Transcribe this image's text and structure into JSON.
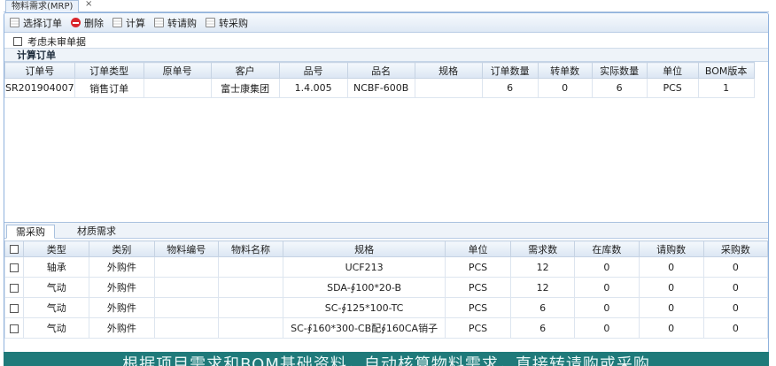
{
  "window": {
    "tab_title": "物料需求(MRP)",
    "close_glyph": "×"
  },
  "toolbar": {
    "select_order": "选择订单",
    "delete": "删除",
    "calculate": "计算",
    "to_request": "转请购",
    "to_purchase": "转采购"
  },
  "option": {
    "label": "考虑未审单据"
  },
  "orders": {
    "title": "计算订单",
    "columns": [
      "订单号",
      "订单类型",
      "原单号",
      "客户",
      "品号",
      "品名",
      "规格",
      "订单数量",
      "转单数",
      "实际数量",
      "单位",
      "BOM版本"
    ],
    "rows": [
      [
        "SR201904007",
        "销售订单",
        "",
        "富士康集团",
        "1.4.005",
        "NCBF-600B",
        "",
        "6",
        "0",
        "6",
        "PCS",
        "1"
      ]
    ]
  },
  "bottom_tabs": [
    "需采购",
    "材质需求"
  ],
  "requirements": {
    "columns": [
      "类型",
      "类别",
      "物料编号",
      "物料名称",
      "规格",
      "单位",
      "需求数",
      "在库数",
      "请购数",
      "采购数"
    ],
    "rows": [
      [
        "轴承",
        "外购件",
        "",
        "",
        "UCF213",
        "PCS",
        "12",
        "0",
        "0",
        "0"
      ],
      [
        "气动",
        "外购件",
        "",
        "",
        "SDA-∮100*20-B",
        "PCS",
        "12",
        "0",
        "0",
        "0"
      ],
      [
        "气动",
        "外购件",
        "",
        "",
        "SC-∮125*100-TC",
        "PCS",
        "6",
        "0",
        "0",
        "0"
      ],
      [
        "气动",
        "外购件",
        "",
        "",
        "SC-∮160*300-CB配∮160CA销子",
        "PCS",
        "6",
        "0",
        "0",
        "0"
      ]
    ]
  },
  "caption": "根据项目需求和BOM基础资料，自动核算物料需求，直接转请购或采购"
}
